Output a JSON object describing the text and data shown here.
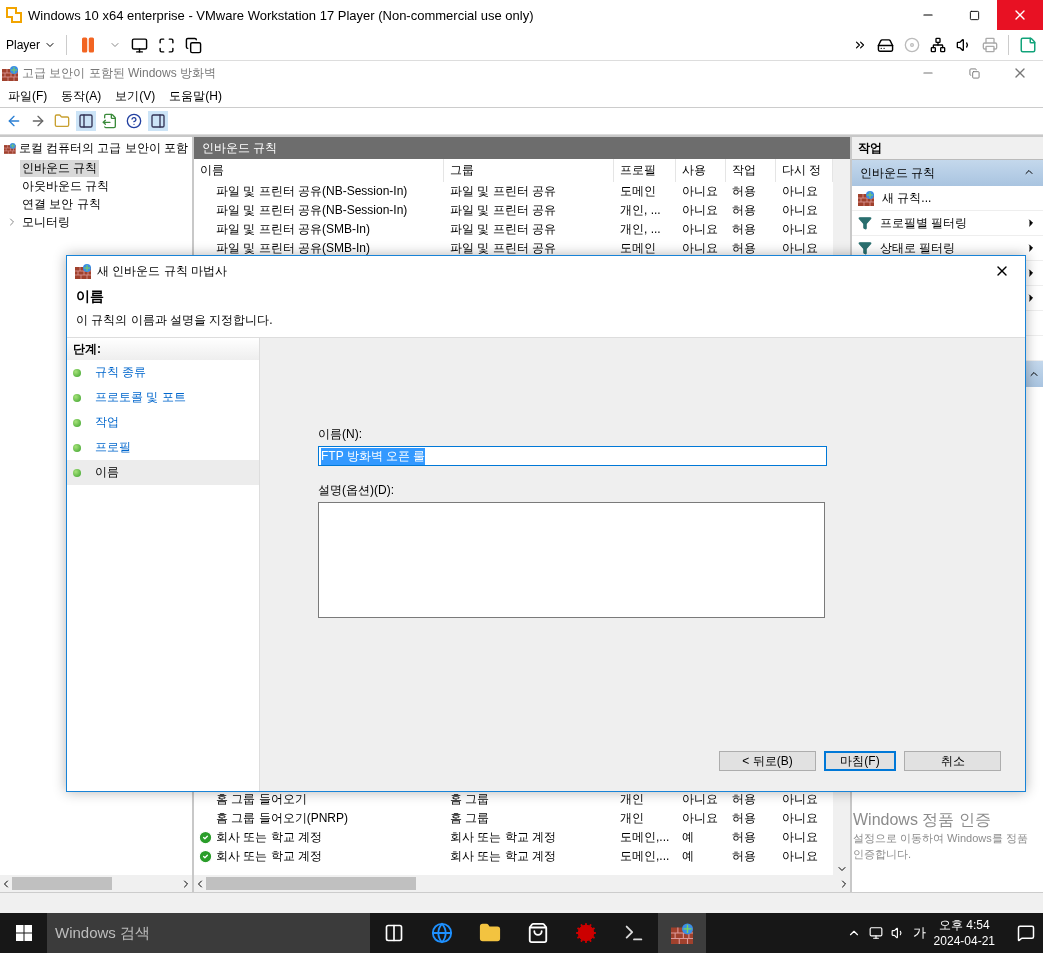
{
  "vm_window": {
    "title": "Windows 10 x64 enterprise - VMware Workstation 17 Player (Non-commercial use only)",
    "player_menu": "Player"
  },
  "mmc": {
    "title": "고급 보안이 포함된 Windows 방화벽",
    "menu": [
      "파일(F)",
      "동작(A)",
      "보기(V)",
      "도움말(H)"
    ]
  },
  "tree": {
    "label": "로컬 컴퓨터의 고급 보안이 포함",
    "children": [
      {
        "label": "인바운드 규칙",
        "selected": true,
        "expandable": false
      },
      {
        "label": "아웃바운드 규칙",
        "selected": false,
        "expandable": false
      },
      {
        "label": "연결 보안 규칙",
        "selected": false,
        "expandable": false
      },
      {
        "label": "모니터링",
        "selected": false,
        "expandable": true
      }
    ]
  },
  "rules_panel": {
    "title": "인바운드 규칙",
    "columns": [
      "이름",
      "그룹",
      "프로필",
      "사용",
      "작업",
      "다시 정"
    ],
    "rows": [
      {
        "name": "파일 및 프린터 공유(NB-Session-In)",
        "group": "파일 및 프린터 공유",
        "profile": "도메인",
        "enabled": "아니요",
        "action": "허용",
        "override": "아니요",
        "active": false
      },
      {
        "name": "파일 및 프린터 공유(NB-Session-In)",
        "group": "파일 및 프린터 공유",
        "profile": "개인, ...",
        "enabled": "아니요",
        "action": "허용",
        "override": "아니요",
        "active": false
      },
      {
        "name": "파일 및 프린터 공유(SMB-In)",
        "group": "파일 및 프린터 공유",
        "profile": "개인, ...",
        "enabled": "아니요",
        "action": "허용",
        "override": "아니요",
        "active": false
      },
      {
        "name": "파일 및 프린터 공유(SMB-In)",
        "group": "파일 및 프린터 공유",
        "profile": "도메인",
        "enabled": "아니요",
        "action": "허용",
        "override": "아니요",
        "active": false
      }
    ],
    "rows_after_dialog": [
      {
        "name": "홈 그룹 들어오기",
        "group": "홈 그룹",
        "profile": "개인",
        "enabled": "아니요",
        "action": "허용",
        "override": "아니요",
        "active": false
      },
      {
        "name": "홈 그룹 들어오기(PNRP)",
        "group": "홈 그룹",
        "profile": "개인",
        "enabled": "아니요",
        "action": "허용",
        "override": "아니요",
        "active": false
      },
      {
        "name": "회사 또는 학교 계정",
        "group": "회사 또는 학교 계정",
        "profile": "도메인,...",
        "enabled": "예",
        "action": "허용",
        "override": "아니요",
        "active": true
      },
      {
        "name": "회사 또는 학교 계정",
        "group": "회사 또는 학교 계정",
        "profile": "도메인,...",
        "enabled": "예",
        "action": "허용",
        "override": "아니요",
        "active": true
      }
    ]
  },
  "actions": {
    "title": "작업",
    "section": {
      "label": "인바운드 규칙",
      "expanded": true
    },
    "items": [
      {
        "label": "새 규칙...",
        "kind": "new"
      },
      {
        "label": "프로필별 필터링",
        "kind": "submenu"
      },
      {
        "label": "상태로 필터링",
        "kind": "submenu"
      }
    ],
    "covered_items": [
      {
        "kind": "submenu"
      },
      {
        "kind": "submenu"
      },
      {
        "kind": "blank"
      },
      {
        "kind": "blank"
      },
      {
        "kind": "section"
      }
    ]
  },
  "activation_notice": [
    "Windows 정품 인증",
    "설정으로 이동하여 Windows를 정품",
    "인증합니다."
  ],
  "dialog": {
    "title": "새 인바운드 규칙 마법사",
    "heading": "이름",
    "description": "이 규칙의 이름과 설명을 지정합니다.",
    "steps_title": "단계:",
    "steps": [
      {
        "label": "규칙 종류",
        "selected": false
      },
      {
        "label": "프로토콜 및 포트",
        "selected": false
      },
      {
        "label": "작업",
        "selected": false
      },
      {
        "label": "프로필",
        "selected": false
      },
      {
        "label": "이름",
        "selected": true
      }
    ],
    "name_label": "이름(N):",
    "name_value": "FTP 방화벽 오픈 룰",
    "description_label": "설명(옵션)(D):",
    "buttons": [
      {
        "label": "< 뒤로(B)",
        "default": false
      },
      {
        "label": "마침(F)",
        "default": true
      },
      {
        "label": "취소",
        "default": false
      }
    ]
  },
  "taskbar": {
    "search_placeholder": "Windows 검색",
    "apps": [
      {
        "kind": "task-view",
        "active": false
      },
      {
        "kind": "browser",
        "active": false
      },
      {
        "kind": "explorer",
        "active": false
      },
      {
        "kind": "store",
        "active": false
      },
      {
        "kind": "ftp",
        "active": false
      },
      {
        "kind": "terminal",
        "active": false
      },
      {
        "kind": "firewall",
        "active": true
      }
    ],
    "ime": "가",
    "time": "오후 4:54",
    "date": "2024-04-21"
  }
}
